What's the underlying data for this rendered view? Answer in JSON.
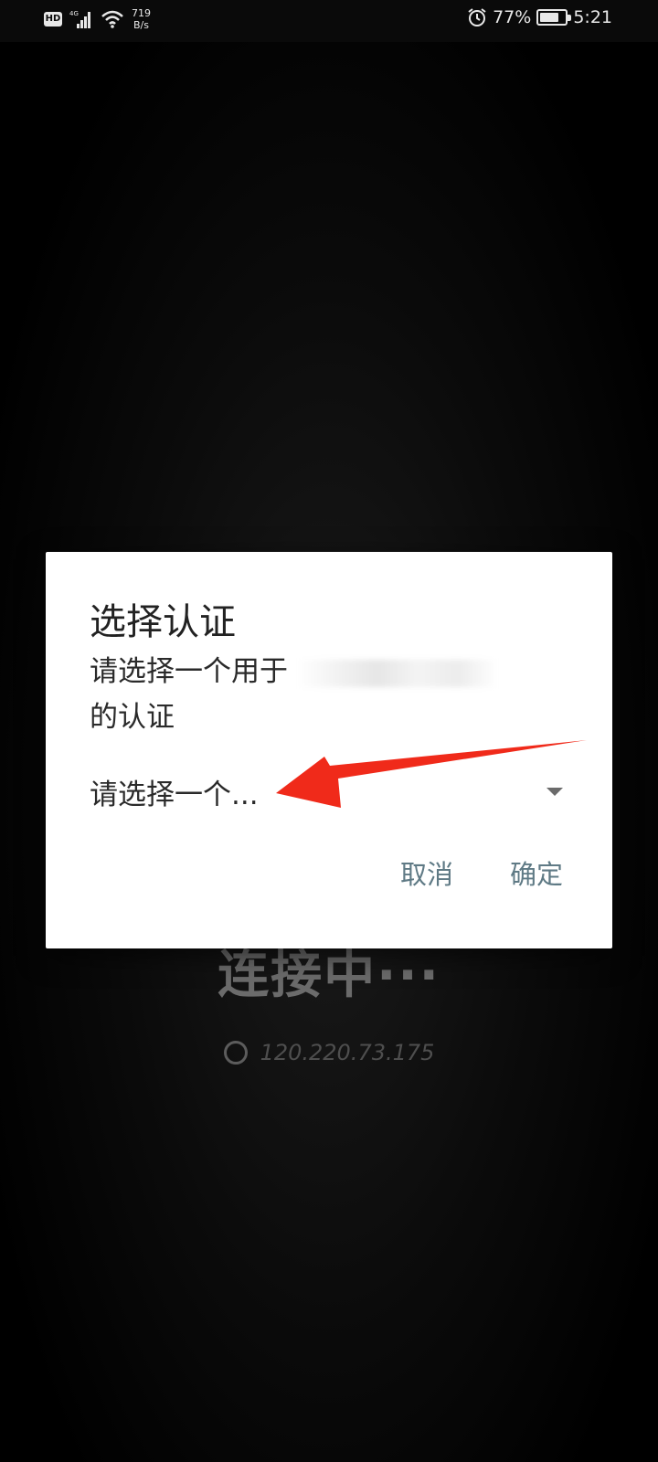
{
  "status_bar": {
    "hd_label": "HD",
    "net_speed_value": "719",
    "net_speed_unit": "B/s",
    "battery_percent": "77%",
    "battery_level": 0.77,
    "time": "5:21",
    "icons": [
      "hd-icon",
      "signal-icon",
      "wifi-icon",
      "alarm-icon",
      "battery-icon"
    ]
  },
  "background": {
    "status_text": "连接中···",
    "address": "120.220.73.175"
  },
  "dialog": {
    "title": "选择认证",
    "message_line1": "请选择一个用于",
    "message_line2": "的认证",
    "select_value": "请选择一个...",
    "cancel_label": "取消",
    "confirm_label": "确定",
    "accent_color": "#5f7a85"
  },
  "annotation": {
    "arrow_color": "#f02a1a"
  }
}
